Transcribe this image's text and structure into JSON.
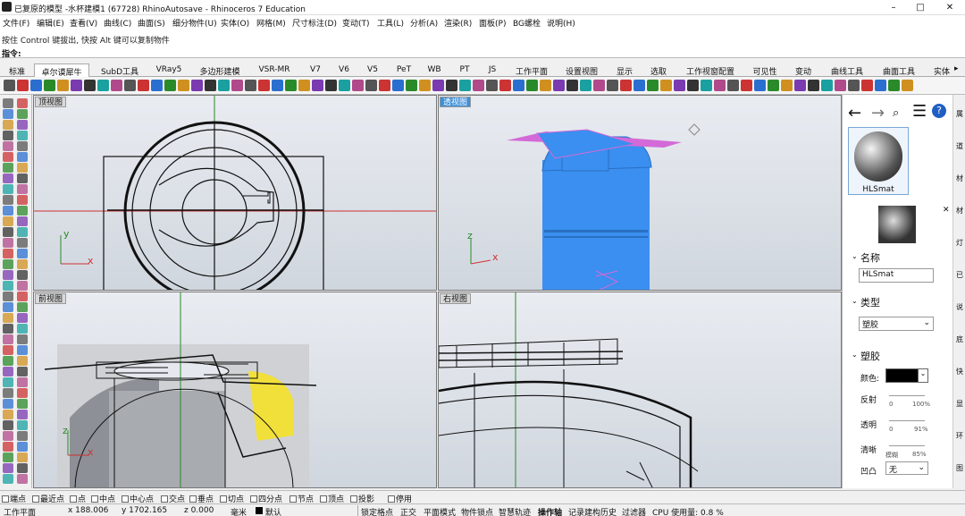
{
  "window": {
    "title": "已复原的模型 -水杯建模1 (67728) RhinoAutosave - Rhinoceros 7 Education",
    "minimize": "–",
    "maximize": "□",
    "close": "✕"
  },
  "menu": [
    "文件(F)",
    "编辑(E)",
    "查看(V)",
    "曲线(C)",
    "曲面(S)",
    "细分物件(U)",
    "实体(O)",
    "网格(M)",
    "尺寸标注(D)",
    "变动(T)",
    "工具(L)",
    "分析(A)",
    "渲染(R)",
    "面板(P)",
    "BG螺栓",
    "说明(H)"
  ],
  "command": {
    "history": "按住 Control 键拔出, 快按 Alt 键可以复制物件",
    "prompt": "指令:",
    "value": ""
  },
  "tabs": [
    {
      "label": "标准"
    },
    {
      "label": "卓尔谟犀牛",
      "active": true
    },
    {
      "label": "SubD工具"
    },
    {
      "label": "VRay5"
    },
    {
      "label": "多边形建模"
    },
    {
      "label": "VSR-MR"
    },
    {
      "label": "V7"
    },
    {
      "label": "V6"
    },
    {
      "label": "V5"
    },
    {
      "label": "PeT"
    },
    {
      "label": "WB"
    },
    {
      "label": "PT"
    },
    {
      "label": "JS"
    },
    {
      "label": "工作平面"
    },
    {
      "label": "设置视图"
    },
    {
      "label": "显示"
    },
    {
      "label": "选取"
    },
    {
      "label": "工作视窗配置"
    },
    {
      "label": "可见性"
    },
    {
      "label": "变动"
    },
    {
      "label": "曲线工具"
    },
    {
      "label": "曲面工具"
    },
    {
      "label": "实体"
    }
  ],
  "viewports": {
    "top": {
      "label": "顶视图",
      "axis_y": "y",
      "axis_x": "x"
    },
    "perspective": {
      "label": "透视图",
      "axis_z": "z",
      "axis_x": "x"
    },
    "front": {
      "label": "前视图",
      "axis_z": "z",
      "axis_x": "x"
    },
    "right": {
      "label": "右视图"
    }
  },
  "panel": {
    "material_name_thumb": "HLSmat",
    "name_header": "名称",
    "name_value": "HLSmat",
    "type_header": "类型",
    "type_value": "塑胶",
    "plastic_header": "塑胶",
    "color_label": "颜色:",
    "reflect_label": "反射",
    "reflect_min": "0",
    "reflect_max": "100%",
    "transp_label": "透明",
    "transp_min": "0",
    "transp_max": "91%",
    "clarity_label": "清晰",
    "clarity_min": "模糊",
    "clarity_max": "85%",
    "bump_label": "凹凸",
    "bump_value": "无",
    "colors": {
      "swatch": "#000000"
    }
  },
  "right_strip": [
    "属",
    "道",
    "材",
    "材",
    "灯",
    "已",
    "说",
    "底",
    "快",
    "显",
    "环",
    "图"
  ],
  "osnaps": [
    {
      "label": "端点",
      "checked": false
    },
    {
      "label": "最近点",
      "checked": false
    },
    {
      "label": "点",
      "checked": false
    },
    {
      "label": "中点",
      "checked": false
    },
    {
      "label": "中心点",
      "checked": false
    },
    {
      "label": "交点",
      "checked": false
    },
    {
      "label": "垂点",
      "checked": false
    },
    {
      "label": "切点",
      "checked": false
    },
    {
      "label": "四分点",
      "checked": false
    },
    {
      "label": "节点",
      "checked": false
    },
    {
      "label": "顶点",
      "checked": false
    },
    {
      "label": "投影",
      "checked": false
    },
    {
      "label": "停用",
      "checked": false
    }
  ],
  "status": {
    "cplane": "工作平面",
    "x": "x 188.006",
    "y": "y 1702.165",
    "z": "z 0.000",
    "unit": "毫米",
    "layer": "默认",
    "grid_snap": "锁定格点",
    "ortho": "正交",
    "planar": "平面模式",
    "osnap": "物件锁点",
    "smarttrack": "智慧轨迹",
    "gumball": "操作轴",
    "history": "记录建构历史",
    "filter": "过滤器",
    "cpu": "CPU 使用量: 0.8 %"
  }
}
